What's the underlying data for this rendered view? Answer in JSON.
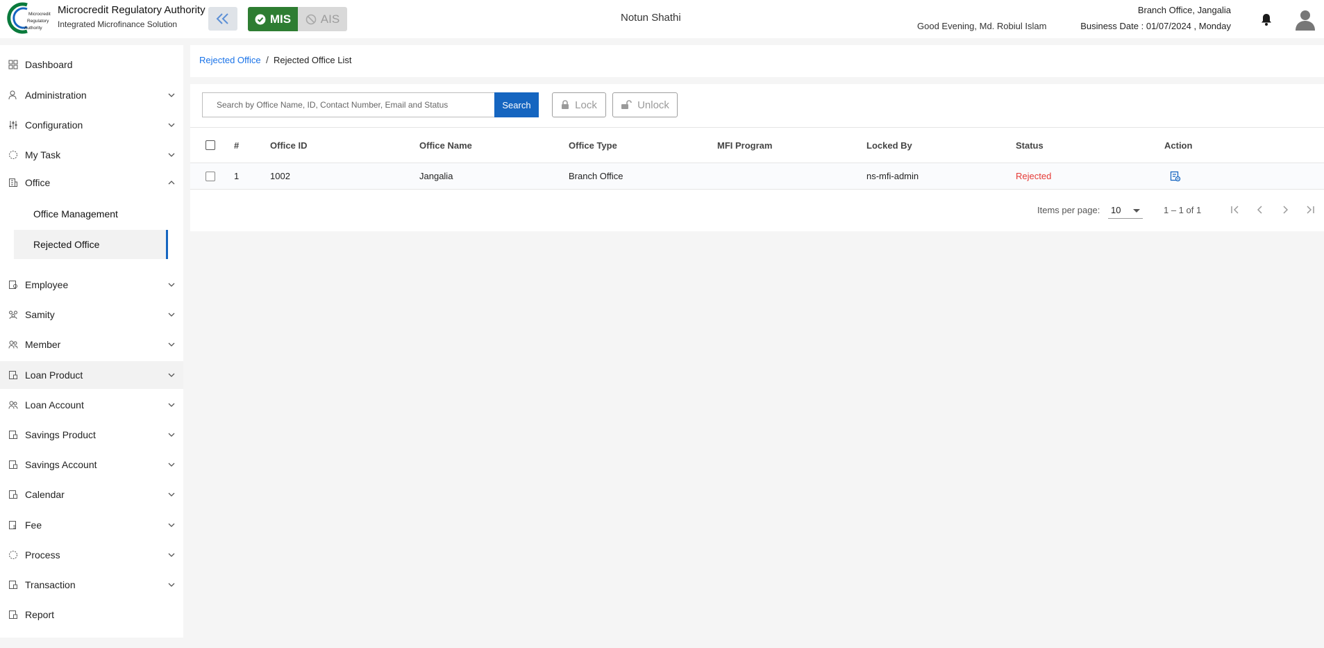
{
  "header": {
    "org_name": "Microcredit Regulatory Authority",
    "org_subtitle": "Integrated Microfinance Solution",
    "logo_text": [
      "Microcredit",
      "Regulatory",
      "Authority"
    ],
    "mode_mis": "MIS",
    "mode_ais": "AIS",
    "app_name": "Notun Shathi",
    "greeting": "Good Evening, Md. Robiul Islam",
    "branch": "Branch Office, Jangalia",
    "business_date": "Business Date : 01/07/2024 , Monday"
  },
  "sidebar": {
    "items": [
      {
        "label": "Dashboard",
        "icon": "dashboard-icon"
      },
      {
        "label": "Administration",
        "icon": "admin-icon"
      },
      {
        "label": "Configuration",
        "icon": "sliders-icon"
      },
      {
        "label": "My Task",
        "icon": "task-icon"
      },
      {
        "label": "Office",
        "icon": "office-icon"
      },
      {
        "label": "Employee",
        "icon": "employee-icon"
      },
      {
        "label": "Samity",
        "icon": "samity-icon"
      },
      {
        "label": "Member",
        "icon": "member-icon"
      },
      {
        "label": "Loan Product",
        "icon": "loan-product-icon"
      },
      {
        "label": "Loan Account",
        "icon": "loan-account-icon"
      },
      {
        "label": "Savings Product",
        "icon": "savings-product-icon"
      },
      {
        "label": "Savings Account",
        "icon": "savings-account-icon"
      },
      {
        "label": "Calendar",
        "icon": "calendar-icon"
      },
      {
        "label": "Fee",
        "icon": "fee-icon"
      },
      {
        "label": "Process",
        "icon": "process-icon"
      },
      {
        "label": "Transaction",
        "icon": "transaction-icon"
      },
      {
        "label": "Report",
        "icon": "report-icon"
      }
    ],
    "office_sub": [
      "Office Management",
      "Rejected Office"
    ]
  },
  "breadcrumb": {
    "parent": "Rejected Office",
    "separator": "/",
    "current": "Rejected Office List"
  },
  "toolbar": {
    "search_placeholder": "Search by Office Name, ID, Contact Number, Email and Status",
    "search_label": "Search",
    "lock_label": "Lock",
    "unlock_label": "Unlock"
  },
  "table": {
    "columns": [
      "#",
      "Office ID",
      "Office Name",
      "Office Type",
      "MFI Program",
      "Locked By",
      "Status",
      "Action"
    ],
    "rows": [
      {
        "index": "1",
        "office_id": "1002",
        "office_name": "Jangalia",
        "office_type": "Branch Office",
        "mfi_program": "",
        "locked_by": "ns-mfi-admin",
        "status": "Rejected"
      }
    ]
  },
  "paginator": {
    "items_per_page_label": "Items per page:",
    "items_per_page": "10",
    "range": "1 – 1 of 1"
  },
  "colors": {
    "brand_blue": "#1565c0",
    "mis_green": "#2e7d32",
    "rejected_red": "#e53935"
  }
}
